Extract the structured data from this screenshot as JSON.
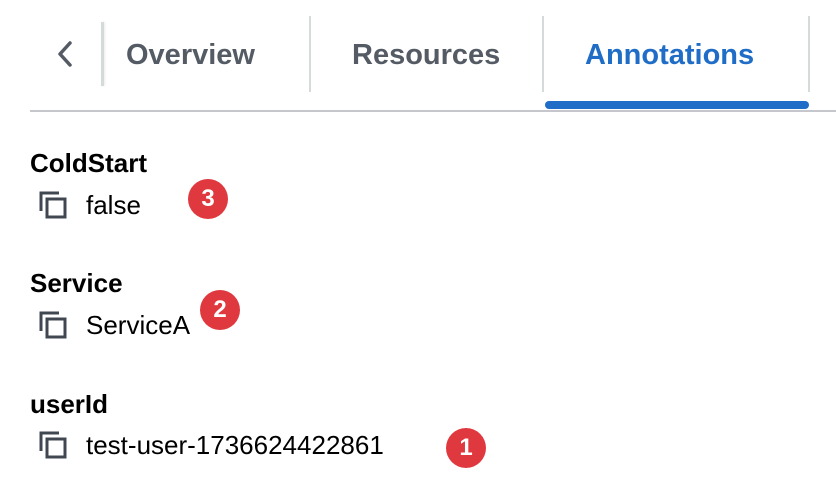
{
  "tabs": {
    "items": [
      {
        "label": "Overview",
        "active": false
      },
      {
        "label": "Resources",
        "active": false
      },
      {
        "label": "Annotations",
        "active": true
      }
    ],
    "back_icon": "chevron-left-icon"
  },
  "annotations": [
    {
      "key": "ColdStart",
      "value": "false",
      "badge": "3"
    },
    {
      "key": "Service",
      "value": "ServiceA",
      "badge": "2"
    },
    {
      "key": "userId",
      "value": "test-user-1736624422861",
      "badge": "1"
    }
  ],
  "icons": {
    "copy": "copy-icon"
  },
  "colors": {
    "accent": "#1f6dc6",
    "inactive_tab": "#545b64",
    "badge": "#e0383f",
    "divider": "#c6c6cd"
  }
}
